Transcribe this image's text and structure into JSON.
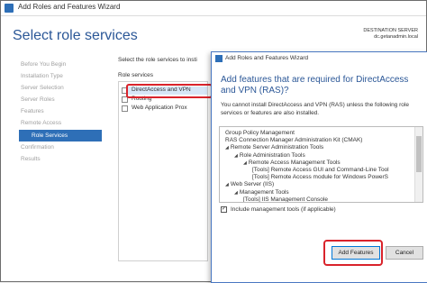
{
  "window": {
    "title": "Add Roles and Features Wizard"
  },
  "header": {
    "page_title": "Select role services",
    "dest_label": "DESTINATION SERVER",
    "dest_server": "dc.getanadmin.local"
  },
  "sidebar": {
    "items": [
      {
        "label": "Before You Begin"
      },
      {
        "label": "Installation Type"
      },
      {
        "label": "Server Selection"
      },
      {
        "label": "Server Roles"
      },
      {
        "label": "Features"
      },
      {
        "label": "Remote Access"
      },
      {
        "label": "Role Services"
      },
      {
        "label": "Confirmation"
      },
      {
        "label": "Results"
      }
    ]
  },
  "main": {
    "description": "Select the role services to insti",
    "role_services_label": "Role services",
    "role_services": [
      {
        "label": "DirectAccess and VPN"
      },
      {
        "label": "Routing"
      },
      {
        "label": "Web Application Prox"
      }
    ]
  },
  "dialog": {
    "title": "Add Roles and Features Wizard",
    "heading": "Add features that are required for DirectAccess and VPN (RAS)?",
    "body": "You cannot install DirectAccess and VPN (RAS) unless the following role services or features are also installed.",
    "features": [
      {
        "label": "Group Policy Management",
        "indent": 0,
        "arrow": false
      },
      {
        "label": "RAS Connection Manager Administration Kit (CMAK)",
        "indent": 0,
        "arrow": false
      },
      {
        "label": "Remote Server Administration Tools",
        "indent": 0,
        "arrow": true
      },
      {
        "label": "Role Administration Tools",
        "indent": 1,
        "arrow": true
      },
      {
        "label": "Remote Access Management Tools",
        "indent": 2,
        "arrow": true
      },
      {
        "label": "[Tools] Remote Access GUI and Command-Line Tool",
        "indent": 3,
        "arrow": false
      },
      {
        "label": "[Tools] Remote Access module for Windows PowerS",
        "indent": 3,
        "arrow": false
      },
      {
        "label": "Web Server (IIS)",
        "indent": 0,
        "arrow": true
      },
      {
        "label": "Management Tools",
        "indent": 1,
        "arrow": true
      },
      {
        "label": "[Tools] IIS Management Console",
        "indent": 2,
        "arrow": false
      },
      {
        "label": "IIS Management Scripts and Tools",
        "indent": 2,
        "arrow": false
      }
    ],
    "include_label": "Include management tools (if applicable)",
    "include_checked": "✓",
    "add_button": "Add Features",
    "cancel_button": "Cancel"
  }
}
